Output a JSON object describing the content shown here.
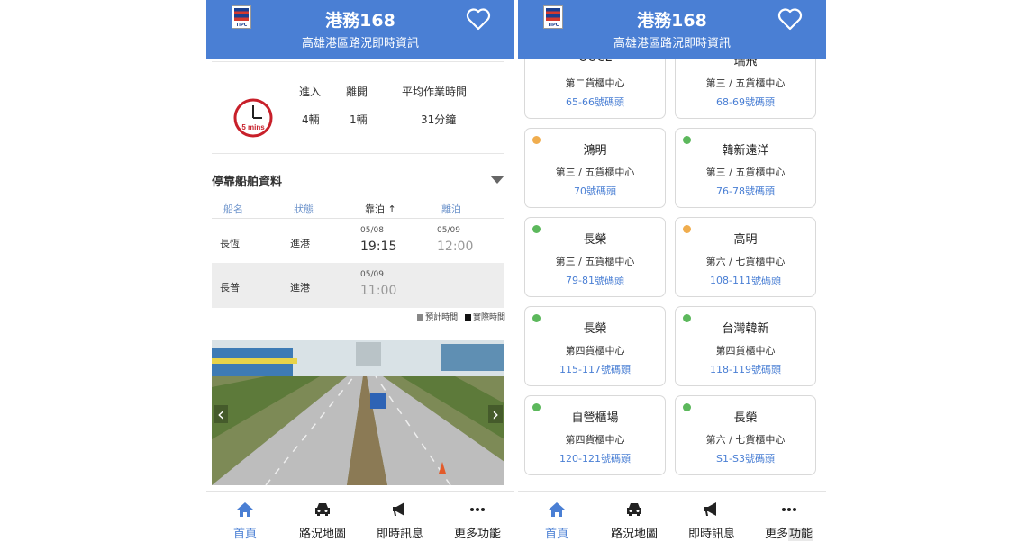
{
  "app": {
    "title": "港務168",
    "subtitle": "高雄港區路況即時資訊",
    "logo_text": "TIPC"
  },
  "tabs": [
    {
      "label": "首頁",
      "icon": "home-icon"
    },
    {
      "label": "路況地圖",
      "icon": "car-icon"
    },
    {
      "label": "即時訊息",
      "icon": "megaphone-icon"
    },
    {
      "label": "更多功能",
      "icon": "more-icon"
    }
  ],
  "tab2_more_label_parts": [
    "更多",
    "功能"
  ],
  "screen1": {
    "clock_label": "5 mins",
    "stats": {
      "in_label": "進入",
      "out_label": "離開",
      "avg_label": "平均作業時間",
      "in_value": "4輛",
      "out_value": "1輛",
      "avg_value": "31分鐘"
    },
    "section_title": "停靠船舶資料",
    "table": {
      "headers": [
        "船名",
        "狀態",
        "靠泊",
        "離泊"
      ],
      "sort_indicator": "↑",
      "rows": [
        {
          "name": "長恆",
          "status": "進港",
          "berth_date": "05/08",
          "berth_time": "19:15",
          "depart_date": "05/09",
          "depart_time": "12:00"
        },
        {
          "name": "長普",
          "status": "進港",
          "berth_date": "05/09",
          "berth_time": "11:00",
          "depart_date": "",
          "depart_time": ""
        }
      ]
    },
    "legend": {
      "estimated": "預計時間",
      "actual": "實際時間",
      "estimated_color": "#888888",
      "actual_color": "#111111"
    },
    "camera": {
      "prev_symbol": "‹",
      "next_symbol": "›"
    }
  },
  "screen2": {
    "status_colors": {
      "green": "#5cb85c",
      "yellow": "#f0ad4e"
    },
    "cards": [
      {
        "name": "OOCL",
        "center": "第二貨櫃中心",
        "berth": "65-66號碼頭",
        "status": ""
      },
      {
        "name": "瑞飛",
        "center": "第三 / 五貨櫃中心",
        "berth": "68-69號碼頭",
        "status": ""
      },
      {
        "name": "鴻明",
        "center": "第三 / 五貨櫃中心",
        "berth": "70號碼頭",
        "status": "yellow"
      },
      {
        "name": "韓新遠洋",
        "center": "第三 / 五貨櫃中心",
        "berth": "76-78號碼頭",
        "status": "green"
      },
      {
        "name": "長榮",
        "center": "第三 / 五貨櫃中心",
        "berth": "79-81號碼頭",
        "status": "green"
      },
      {
        "name": "高明",
        "center": "第六 / 七貨櫃中心",
        "berth": "108-111號碼頭",
        "status": "yellow"
      },
      {
        "name": "長榮",
        "center": "第四貨櫃中心",
        "berth": "115-117號碼頭",
        "status": "green"
      },
      {
        "name": "台灣韓新",
        "center": "第四貨櫃中心",
        "berth": "118-119號碼頭",
        "status": "green"
      },
      {
        "name": "自營櫃場",
        "center": "第四貨櫃中心",
        "berth": "120-121號碼頭",
        "status": "green"
      },
      {
        "name": "長榮",
        "center": "第六 / 七貨櫃中心",
        "berth": "S1-S3號碼頭",
        "status": "green"
      }
    ]
  },
  "colors": {
    "brand": "#4a7fd4",
    "link": "#6f95cc"
  }
}
